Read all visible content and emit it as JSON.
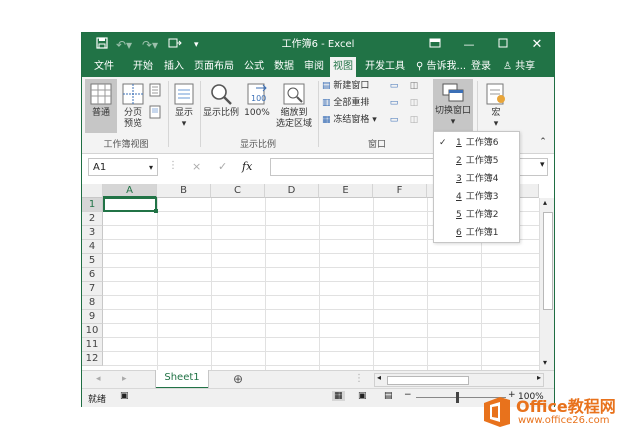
{
  "titlebar": {
    "title": "工作簿6 - Excel",
    "icons": {
      "save": "save-icon",
      "undo": "undo-icon",
      "redo": "redo-icon",
      "touch": "touch-mode-icon",
      "customize": "customize-qat-icon",
      "ribbon_display": "ribbon-display-icon",
      "minimize": "minimize-icon",
      "restore": "restore-icon",
      "close": "close-icon"
    }
  },
  "menu_tabs": [
    "文件",
    "开始",
    "插入",
    "页面布局",
    "公式",
    "数据",
    "审阅",
    "视图",
    "开发工具"
  ],
  "active_tab": "视图",
  "tell_me": "告诉我...",
  "login": "登录",
  "share": "共享",
  "ribbon": {
    "normal": "普通",
    "page_break": "分页\n预览",
    "group_workbook_views": "工作簿视图",
    "show": "显示",
    "zoom": "显示比例",
    "zoom100": "100%",
    "zoom_selection": "缩放到\n选定区域",
    "group_zoom": "显示比例",
    "new_window": "新建窗口",
    "arrange_all": "全部重排",
    "freeze_panes": "冻结窗格",
    "group_window": "窗口",
    "switch_windows": "切换窗口",
    "macros": "宏"
  },
  "formula_bar": {
    "name_box": "A1",
    "fx": "fx",
    "cancel": "×",
    "enter": "✓"
  },
  "columns": [
    "A",
    "B",
    "C",
    "D",
    "E",
    "F"
  ],
  "rows": [
    "1",
    "2",
    "3",
    "4",
    "5",
    "6",
    "7",
    "8",
    "9",
    "10",
    "11",
    "12"
  ],
  "sheet_tab": "Sheet1",
  "status": {
    "ready": "就绪",
    "zoom": "100%"
  },
  "switch_menu": [
    {
      "num": "1",
      "name": "工作簿6",
      "checked": true
    },
    {
      "num": "2",
      "name": "工作簿5",
      "checked": false
    },
    {
      "num": "3",
      "name": "工作簿4",
      "checked": false
    },
    {
      "num": "4",
      "name": "工作簿3",
      "checked": false
    },
    {
      "num": "5",
      "name": "工作簿2",
      "checked": false
    },
    {
      "num": "6",
      "name": "工作簿1",
      "checked": false
    }
  ],
  "watermark": {
    "brand": "Office教程网",
    "url": "www.office26.com"
  },
  "colors": {
    "excel_green": "#217346",
    "active_cell_border": "#217346",
    "logo_orange": "#e8721c"
  }
}
